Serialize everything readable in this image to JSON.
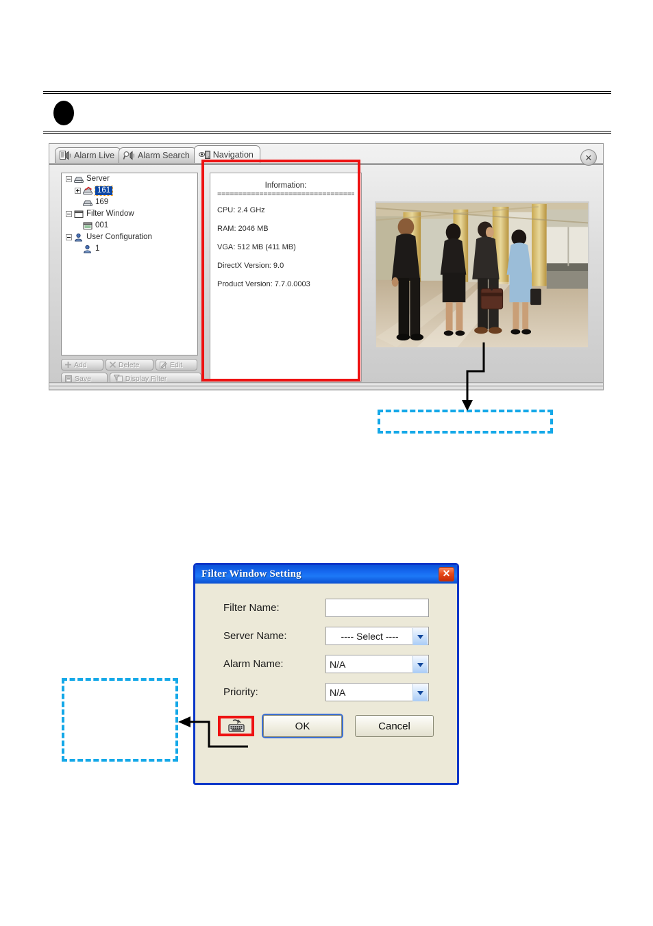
{
  "page": {
    "section_bullet": "•"
  },
  "app_window": {
    "close_button": "✕",
    "tabs": [
      {
        "label": "Alarm Live",
        "icon": "alarm-live-icon",
        "active": false
      },
      {
        "label": "Alarm Search",
        "icon": "alarm-search-icon",
        "active": false
      },
      {
        "label": "Navigation",
        "icon": "navigation-eye-icon",
        "active": true
      }
    ],
    "tree": {
      "nodes": [
        {
          "label": "Server",
          "icon": "server-icon",
          "expander": "minus",
          "indent": 0,
          "selected": false
        },
        {
          "label": "161",
          "icon": "server-alarm-icon",
          "expander": "plus",
          "indent": 1,
          "selected": true
        },
        {
          "label": "169",
          "icon": "server-icon",
          "expander": "none",
          "indent": 1,
          "selected": false
        },
        {
          "label": "Filter Window",
          "icon": "filter-window-icon",
          "expander": "minus",
          "indent": 0,
          "selected": false
        },
        {
          "label": "001",
          "icon": "filter-window-icon",
          "expander": "none",
          "indent": 1,
          "selected": false
        },
        {
          "label": "User Configuration",
          "icon": "user-icon",
          "expander": "minus",
          "indent": 0,
          "selected": false
        },
        {
          "label": "1",
          "icon": "user-icon",
          "expander": "none",
          "indent": 1,
          "selected": false
        }
      ]
    },
    "buttons": {
      "add": "Add",
      "delete": "Delete",
      "edit": "Edit",
      "save": "Save",
      "display_filter": "Display Filter"
    },
    "information_panel": {
      "title": "Information:",
      "divider": "================================================",
      "lines": [
        "CPU: 2.4 GHz",
        "RAM: 2046 MB",
        "VGA: 512 MB (411 MB)",
        "DirectX Version: 9.0",
        "Product Version: 7.7.0.0003"
      ]
    },
    "video_preview": {
      "description": "four-people-walking-corridor-photo"
    }
  },
  "annotations": {
    "highlight_color": "#ee1111",
    "callout_color": "#14a8e8",
    "callout_top_text": "",
    "callout_bottom_text": ""
  },
  "dialog": {
    "title": "Filter Window Setting",
    "close_button": "✕",
    "fields": [
      {
        "label": "Filter Name:",
        "type": "text",
        "value": "",
        "placeholder": ""
      },
      {
        "label": "Server Name:",
        "type": "select",
        "value": "----  Select  ----"
      },
      {
        "label": "Alarm Name:",
        "type": "select",
        "value": "N/A"
      },
      {
        "label": "Priority:",
        "type": "select",
        "value": "N/A"
      }
    ],
    "keyboard_button_icon": "virtual-keyboard-icon",
    "ok_label": "OK",
    "cancel_label": "Cancel",
    "select_arrow": "⌄"
  }
}
